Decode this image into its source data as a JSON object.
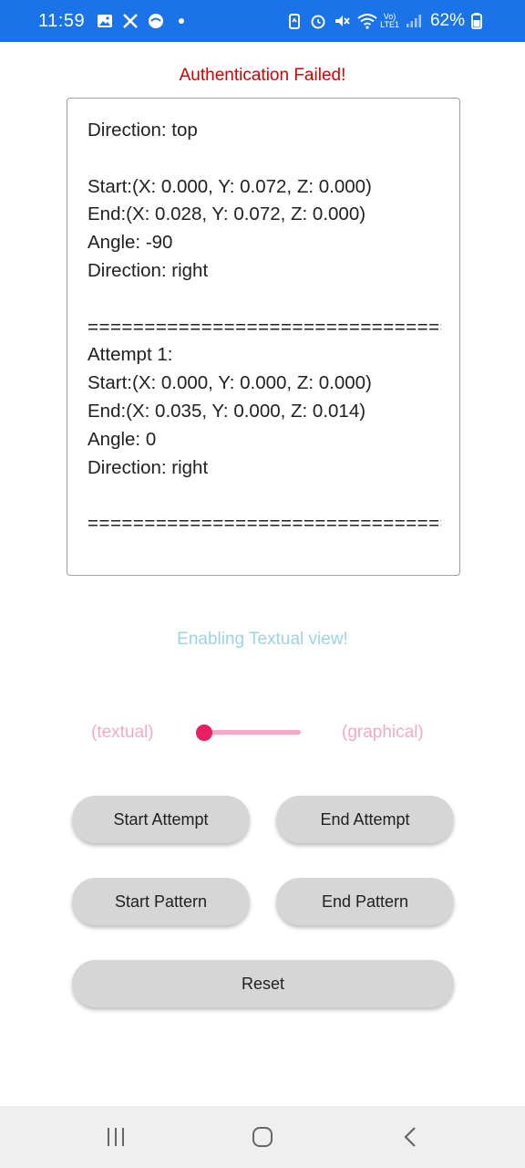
{
  "status_bar": {
    "time": "11:59",
    "battery_percent": "62%",
    "network_label": "LTE1",
    "volte_label": "Vo)",
    "left_icons": [
      "gallery-icon",
      "x-icon",
      "chat-bubble-icon",
      "dot-icon"
    ],
    "right_icons": [
      "battery-saver-icon",
      "alarm-icon",
      "mute-icon",
      "wifi-icon",
      "signal-icon",
      "battery-icon"
    ]
  },
  "auth_message": "Authentication Failed!",
  "log_lines": [
    "Direction: top",
    "",
    "Start:(X: 0.000, Y: 0.072, Z: 0.000)",
    "End:(X: 0.028, Y: 0.072, Z: 0.000)",
    "Angle: -90",
    "Direction: right",
    "",
    "==================================",
    "Attempt 1:",
    "Start:(X: 0.000, Y: 0.000, Z: 0.000)",
    "End:(X: 0.035, Y: 0.000, Z: 0.014)",
    "Angle: 0",
    "Direction: right",
    "",
    "==================================",
    ""
  ],
  "view_message": "Enabling Textual view!",
  "toggle": {
    "left_label": "(textual)",
    "right_label": "(graphical)"
  },
  "buttons": {
    "start_attempt": "Start Attempt",
    "end_attempt": "End Attempt",
    "start_pattern": "Start Pattern",
    "end_pattern": "End Pattern",
    "reset": "Reset"
  },
  "colors": {
    "status_bar": "#1a73e8",
    "error": "#d50000",
    "info": "#9fd3e3",
    "toggle_label": "#f4a9c3",
    "slider_thumb": "#e91e63",
    "button_bg": "#d6d6d6"
  }
}
